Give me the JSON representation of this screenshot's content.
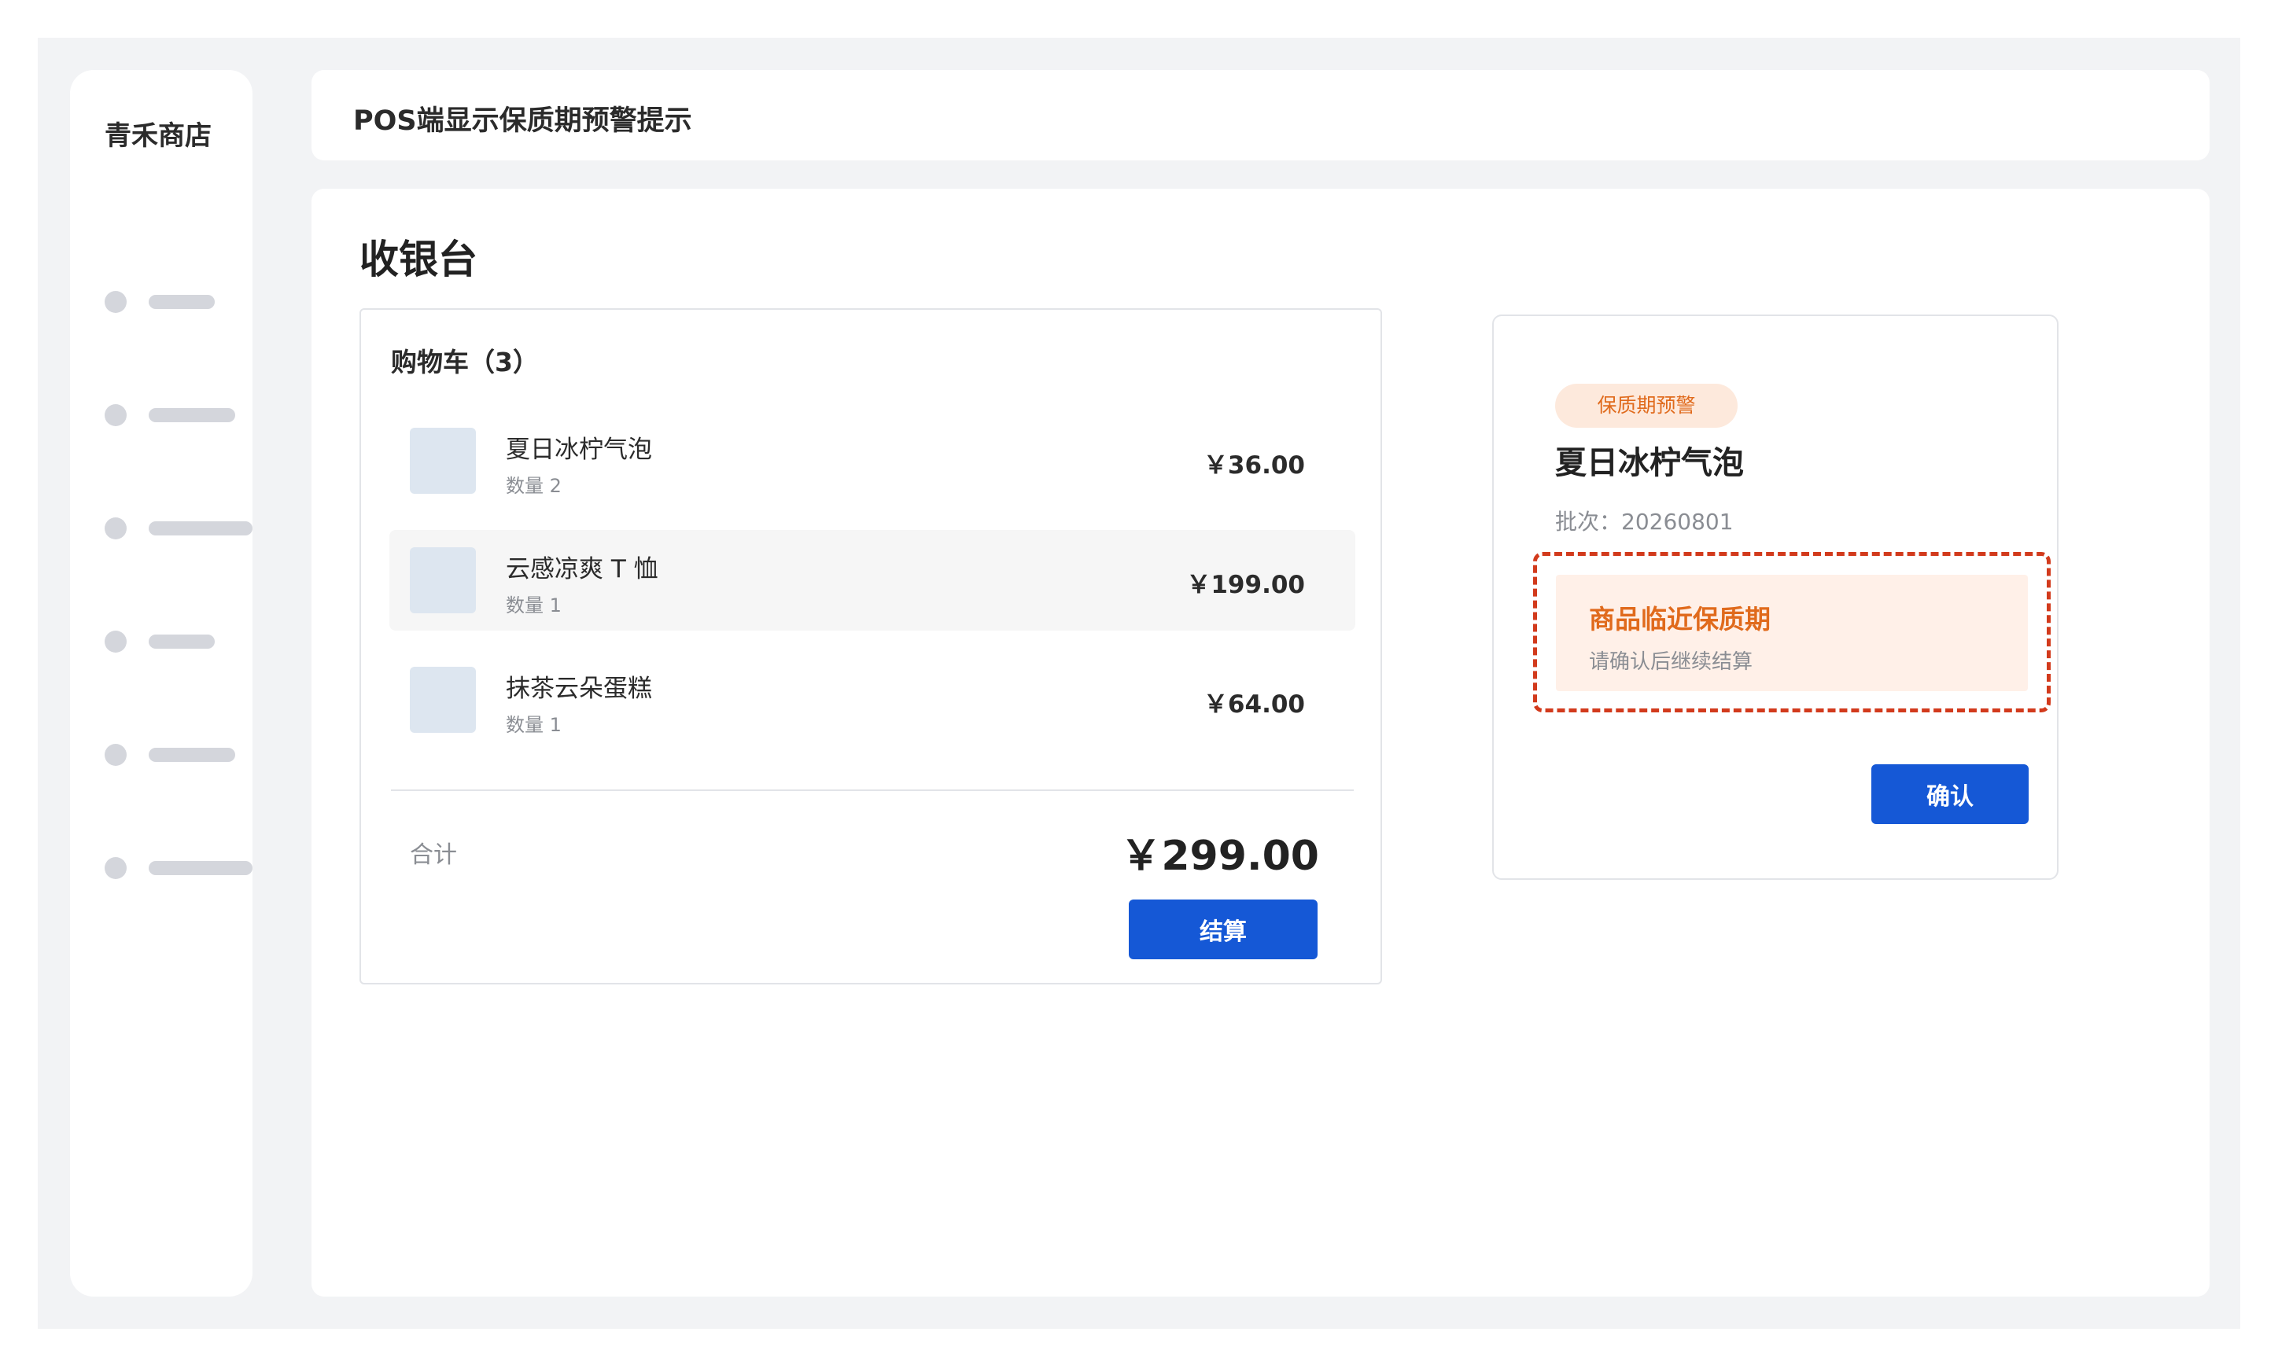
{
  "sidebar": {
    "brand": "青禾商店",
    "items": [
      {
        "icon": "dot"
      },
      {
        "icon": "dot"
      },
      {
        "icon": "dot"
      },
      {
        "icon": "dot"
      },
      {
        "icon": "dot"
      },
      {
        "icon": "dot"
      }
    ]
  },
  "header": {
    "title": "POS端显示保质期预警提示"
  },
  "main": {
    "title": "收银台"
  },
  "cart": {
    "title": "购物车（3）",
    "items": [
      {
        "name": "夏日冰柠气泡",
        "qty": "数量 2",
        "price": "￥36.00"
      },
      {
        "name": "云感凉爽 T 恤",
        "qty": "数量 1",
        "price": "￥199.00"
      },
      {
        "name": "抹茶云朵蛋糕",
        "qty": "数量 1",
        "price": "￥64.00"
      }
    ],
    "total_label": "合计",
    "total_value": "￥299.00",
    "checkout_label": "结算"
  },
  "warning": {
    "badge": "保质期预警",
    "product": "夏日冰柠气泡",
    "batch": "批次：20260801",
    "alert_title": "商品临近保质期",
    "alert_text": "请确认后继续结算",
    "confirm_label": "确认"
  },
  "colors": {
    "primary": "#1558d6",
    "warning_text": "#e06a1c",
    "warning_bg": "#fff0e8",
    "highlight_border": "#d23a1c"
  }
}
